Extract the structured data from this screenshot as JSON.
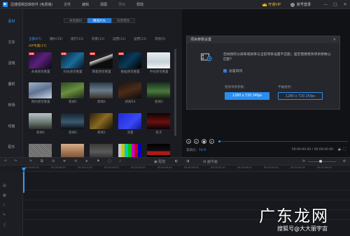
{
  "app": {
    "title": "迅捷视频剪辑软件 (免费版)",
    "menu": [
      "文件",
      "编辑",
      "视图",
      "导出",
      "帮助"
    ],
    "vip_label": "开通VIP",
    "user_label": "账号登录",
    "window_controls": [
      "—",
      "□",
      "✕"
    ]
  },
  "sidebar": {
    "items": [
      {
        "label": "素材",
        "active": true
      },
      {
        "label": "文本",
        "active": false
      },
      {
        "label": "滤镜",
        "active": false
      },
      {
        "label": "叠附",
        "active": false
      },
      {
        "label": "转场",
        "active": false
      },
      {
        "label": "动画",
        "active": false
      },
      {
        "label": "配乐",
        "active": false
      }
    ]
  },
  "library": {
    "tabs": [
      {
        "label": "本地素材",
        "active": false
      },
      {
        "label": "精选片头",
        "active": true
      },
      {
        "label": "背景特效",
        "active": false
      }
    ],
    "filters": [
      {
        "label": "全部(67)",
        "active": true
      },
      {
        "label": "婚纱(15)",
        "active": false
      },
      {
        "label": "旅行(11)",
        "active": false
      },
      {
        "label": "风景(11)",
        "active": false
      },
      {
        "label": "运营(11)",
        "active": false
      },
      {
        "label": "运营(11)",
        "active": false
      },
      {
        "label": "其他(5)",
        "active": false
      }
    ],
    "vip_count": "VIP专属(17)",
    "clips": [
      {
        "label": "未来感觉重置",
        "vip": true
      },
      {
        "label": "科技感觉重置",
        "vip": true
      },
      {
        "label": "像素感觉重置",
        "vip": true
      },
      {
        "label": "数据感觉重置",
        "vip": true
      },
      {
        "label": "手绘感觉重置",
        "vip": false
      },
      {
        "label": "简约感觉重置",
        "vip": false
      },
      {
        "label": "新闻5",
        "vip": false
      },
      {
        "label": "新闻4",
        "vip": false
      },
      {
        "label": "新闻54",
        "vip": false
      },
      {
        "label": "新闻5",
        "vip": false
      },
      {
        "label": "新闻4",
        "vip": false
      },
      {
        "label": "新闻4",
        "vip": false
      },
      {
        "label": "新闻1",
        "vip": false
      },
      {
        "label": "流量",
        "vip": false
      },
      {
        "label": "蛇子",
        "vip": false
      },
      {
        "label": "无信号",
        "vip": false
      },
      {
        "label": "猫咪",
        "vip": false
      },
      {
        "label": "动画字",
        "vip": false
      },
      {
        "label": "信号线上",
        "vip": false
      },
      {
        "label": "Sugar Bomb",
        "vip": false
      }
    ]
  },
  "dialog": {
    "title": "项目参数设置",
    "message": "您视频的分辨率或帧率与当前项目设置不匹配，是否需要更改项目参数以匹配？",
    "checkbox_label": "总是询问",
    "option_change_label": "更改项目参数：",
    "option_change_value": "1280 x 720 24fps",
    "option_keep_label": "不做更改：",
    "option_keep_value": "1280 x 720 25fps"
  },
  "player": {
    "ratio_label": "宽高比：",
    "ratio_value": "16:9",
    "time": "00:00:00.00 / 00:00:00.00"
  },
  "toolbar": {
    "tools": [
      "↶",
      "↷",
      "✎",
      "⧉",
      "⊘",
      "≣",
      "⟲",
      "⧖",
      "⚑",
      "▢",
      "♪",
      "▣ 配音",
      "◐",
      "◑",
      "⊞ 画中画"
    ],
    "zoom_minus": "⊖",
    "zoom_plus": "⊕"
  },
  "ruler": {
    "ticks": [
      "00:00:00.00",
      "00:00:06.00",
      "00:00:12.00",
      "00:00:18.00",
      "00:00:24.00",
      "00:00:30.00",
      "00:00:36.00",
      "00:00:42.00",
      "00:00:48.00",
      "00:00:54.00",
      "00:01:00.00",
      "00:01:06.00"
    ]
  },
  "tracks": [
    "▤",
    "▦",
    "♪",
    "✎",
    "♫",
    "⊞"
  ],
  "watermark": {
    "main": "广东龙网",
    "sub": "搜狐号@大大丽宇宙"
  },
  "colors": {
    "accent": "#2a8df0",
    "vip": "#f0b828",
    "badge": "#e23b3b"
  }
}
